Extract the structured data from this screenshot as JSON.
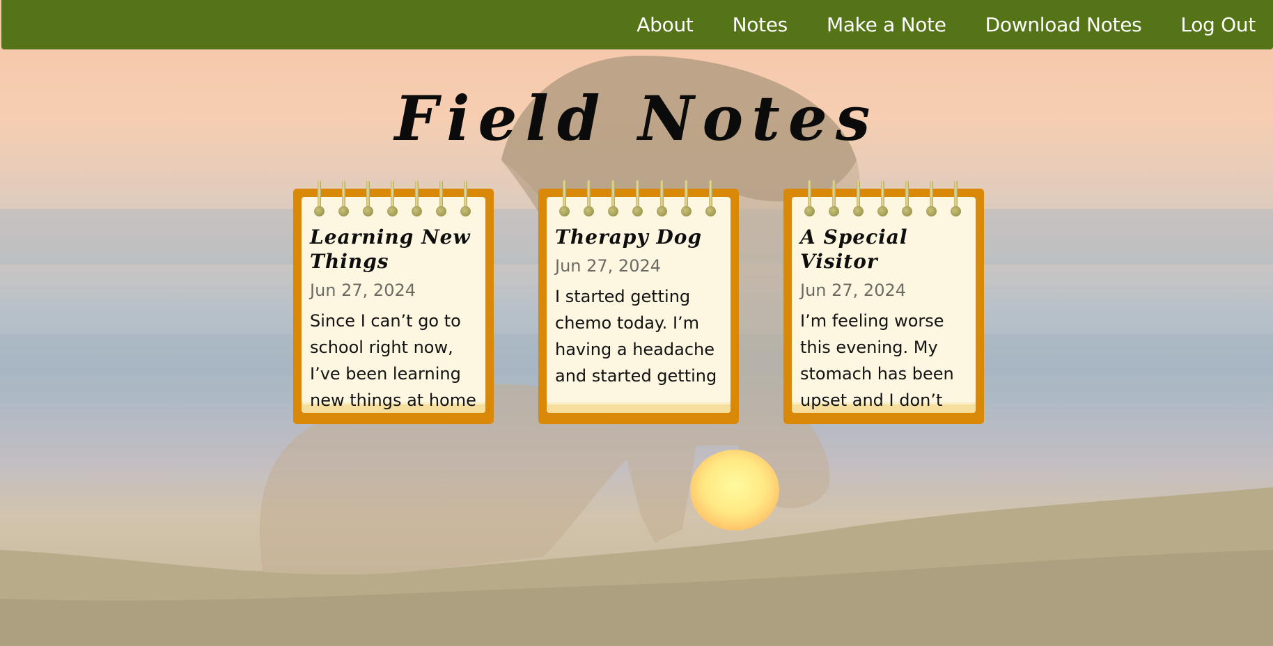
{
  "nav": {
    "items": [
      "About",
      "Notes",
      "Make a Note",
      "Download Notes",
      "Log Out"
    ]
  },
  "page": {
    "title": "Field Notes"
  },
  "notes": [
    {
      "title": "Learning New Things",
      "date": "Jun 27, 2024",
      "body": "Since I can’t go to school right now, I’ve been learning new things at home"
    },
    {
      "title": "Therapy Dog",
      "date": "Jun 27, 2024",
      "body": "I started getting chemo today. I’m having a headache and started getting"
    },
    {
      "title": "A Special Visitor",
      "date": "Jun 27, 2024",
      "body": "I’m feeling worse this evening. My stomach has been upset and I don’t"
    }
  ],
  "colors": {
    "navbar": "#557418",
    "card_frame": "#da8807",
    "paper": "#fdf6e1"
  }
}
